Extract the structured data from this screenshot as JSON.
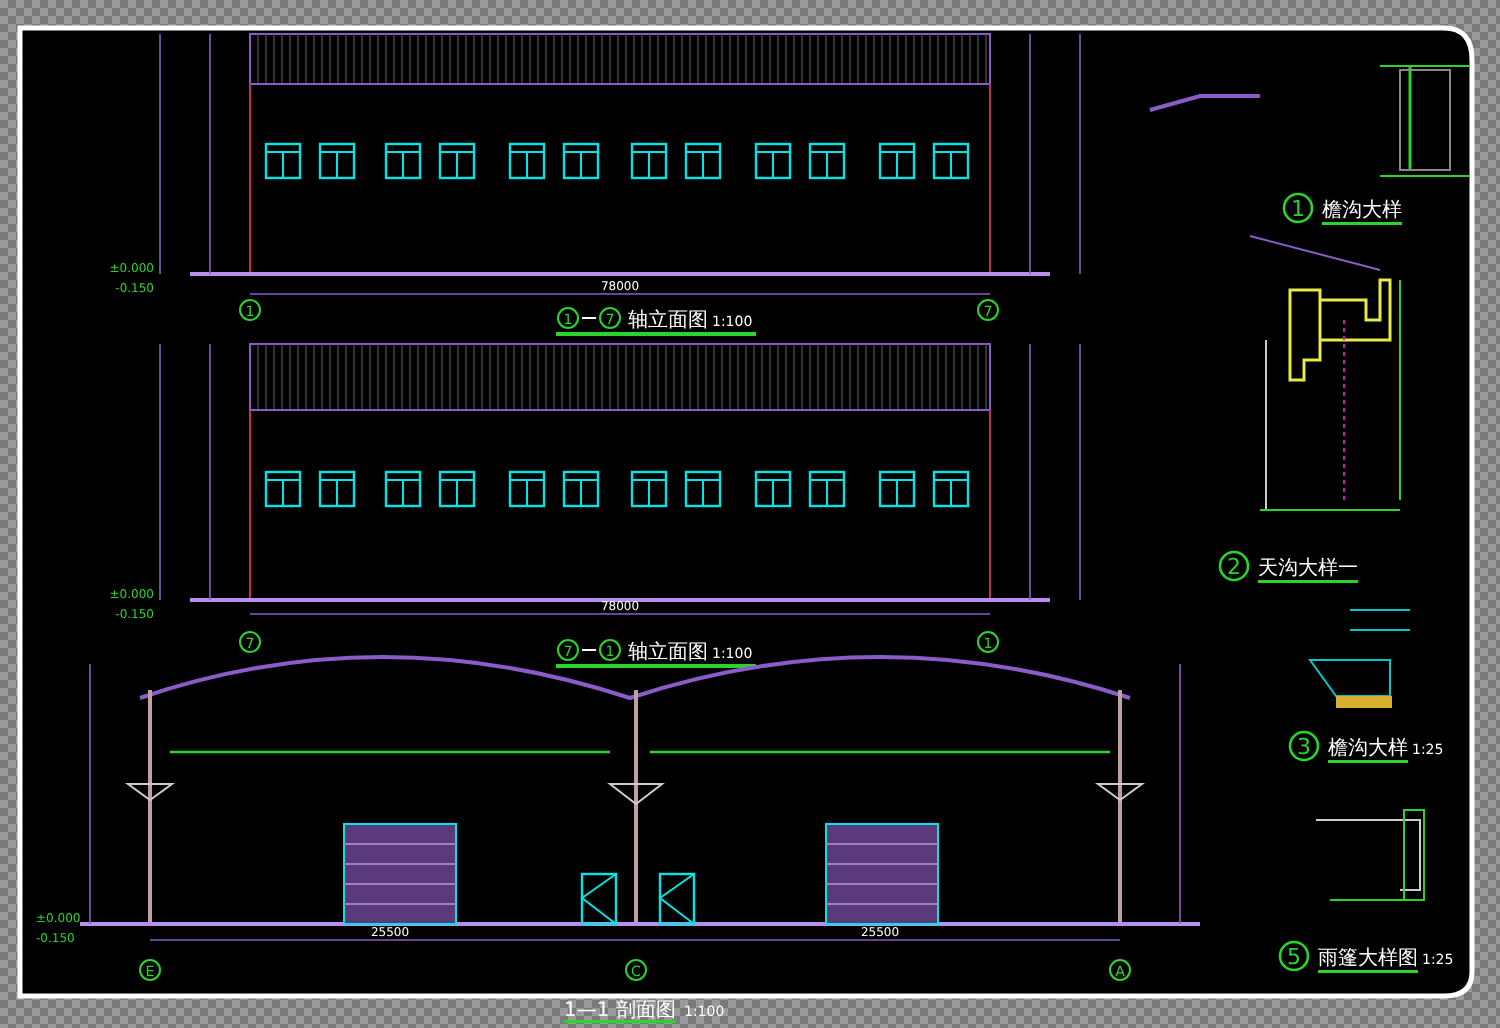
{
  "elevations": [
    {
      "axis_start": "1",
      "axis_end": "7",
      "title_axis_start": "1",
      "title_axis_end": "7",
      "title": "轴立面图",
      "scale": "1:100",
      "span": "78000",
      "levels": [
        "±0.000",
        "-0.150"
      ]
    },
    {
      "axis_start": "7",
      "axis_end": "1",
      "title_axis_start": "7",
      "title_axis_end": "1",
      "title": "轴立面图",
      "scale": "1:100",
      "span": "78000",
      "levels": [
        "±0.000",
        "-0.150"
      ]
    }
  ],
  "section": {
    "title": "1—1 剖面图",
    "scale": "1:100",
    "spans": [
      "25500",
      "25500"
    ],
    "axes": [
      "E",
      "C",
      "A"
    ],
    "levels": [
      "±0.000",
      "-0.150"
    ]
  },
  "details": [
    {
      "number": "1",
      "title": "檐沟大样"
    },
    {
      "number": "2",
      "title": "天沟大样一"
    },
    {
      "number": "3",
      "title": "檐沟大样",
      "scale": "1:25"
    },
    {
      "number": "5",
      "title": "雨篷大样图",
      "scale": "1:25"
    }
  ]
}
